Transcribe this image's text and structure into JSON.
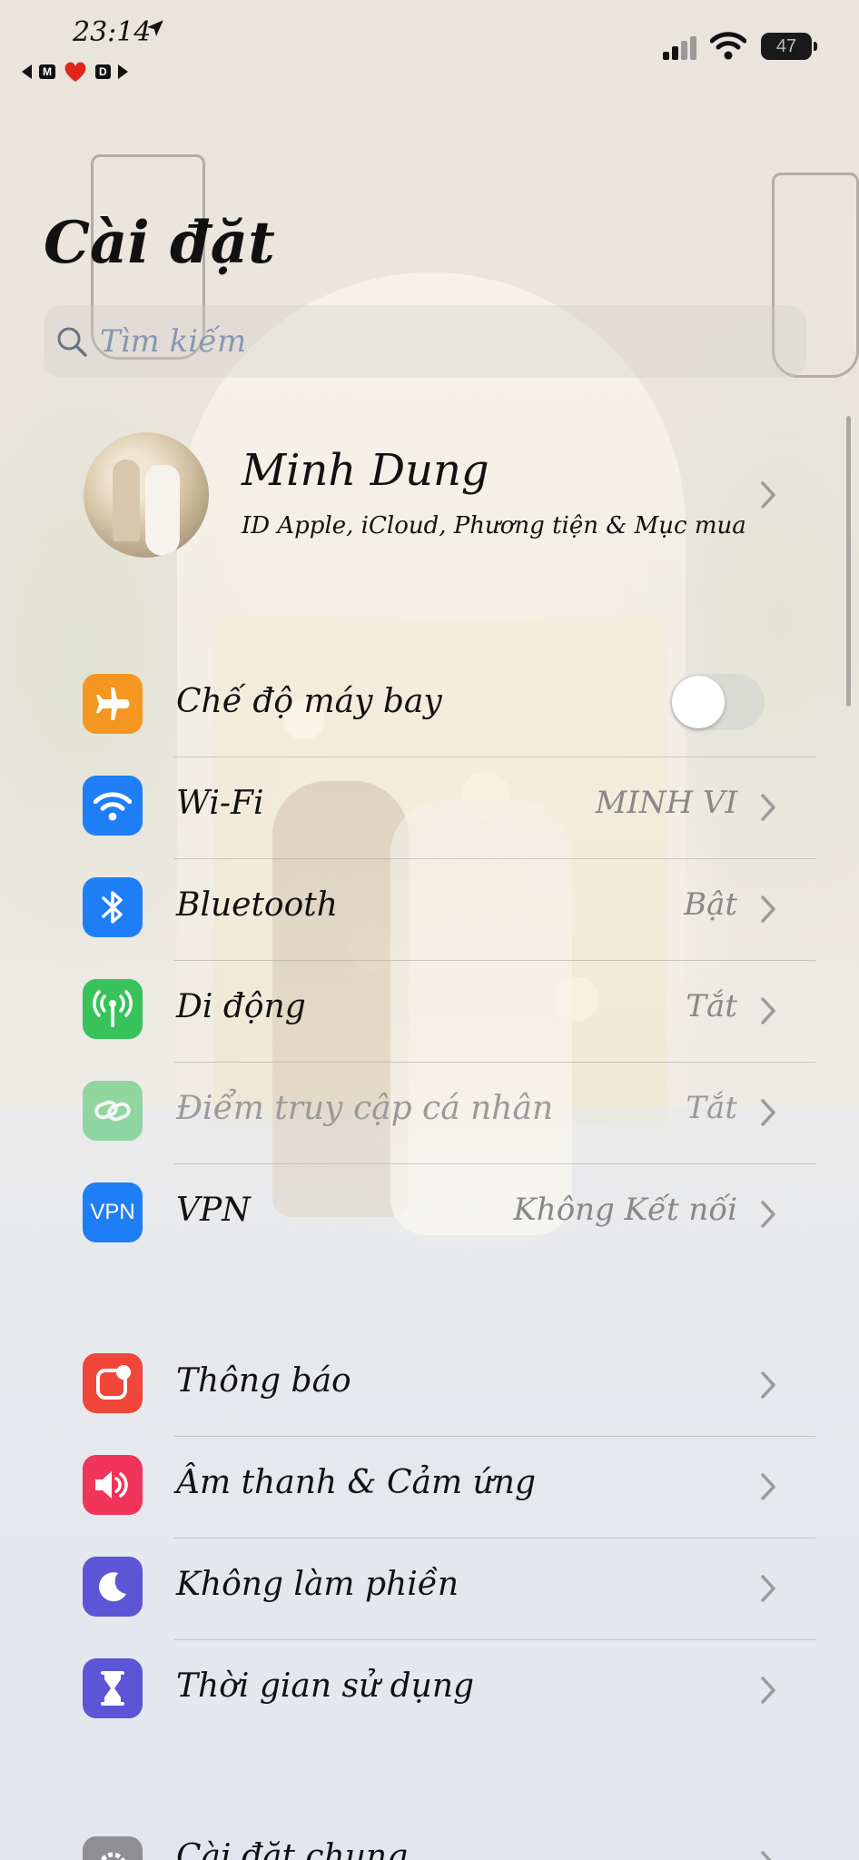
{
  "status": {
    "time": "23:14",
    "sub_left": "M",
    "sub_right": "D",
    "battery": "47"
  },
  "page": {
    "title": "Cài đặt"
  },
  "search": {
    "placeholder": "Tìm kiếm"
  },
  "profile": {
    "name": "Minh Dung",
    "subtitle": "ID Apple, iCloud, Phương tiện & Mục mua"
  },
  "network": [
    {
      "label": "Chế độ máy bay",
      "icon": "airplane-icon",
      "color": "#f4961f",
      "toggle_on": false
    },
    {
      "label": "Wi-Fi",
      "value": "MINH VI",
      "icon": "wifi-icon",
      "color": "#1e7ef6"
    },
    {
      "label": "Bluetooth",
      "value": "Bật",
      "icon": "bluetooth-icon",
      "color": "#1e7ef6"
    },
    {
      "label": "Di động",
      "value": "Tắt",
      "icon": "cellular-icon",
      "color": "#37c25a"
    },
    {
      "label": "Điểm truy cập cá nhân",
      "value": "Tắt",
      "icon": "hotspot-icon",
      "color": "#37c25a",
      "disabled": true
    },
    {
      "label": "VPN",
      "value": "Không Kết nối",
      "icon": "vpn-icon",
      "icon_text": "VPN",
      "color": "#1e7ef6"
    }
  ],
  "general": [
    {
      "label": "Thông báo",
      "icon": "notifications-icon",
      "color": "#f0463a"
    },
    {
      "label": "Âm thanh & Cảm ứng",
      "icon": "sound-icon",
      "color": "#f0345a"
    },
    {
      "label": "Không làm phiền",
      "icon": "moon-icon",
      "color": "#5c55d6"
    },
    {
      "label": "Thời gian sử dụng",
      "icon": "hourglass-icon",
      "color": "#5c55d6"
    }
  ],
  "partial": {
    "label": "Cài đặt chung",
    "icon": "gear-icon",
    "color": "#8e8e93"
  }
}
